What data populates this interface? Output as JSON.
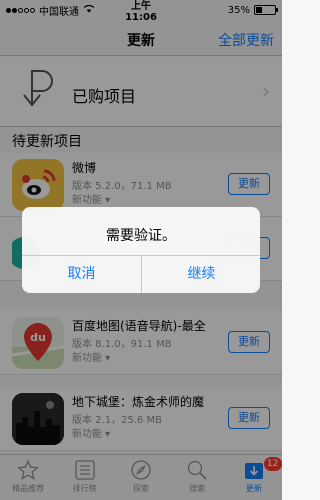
{
  "status_bar": {
    "carrier": "中国联通",
    "time": "上午11:06",
    "battery": "35%",
    "battery_level": 0.35
  },
  "nav": {
    "title": "更新",
    "update_all": "全部更新"
  },
  "purchased": {
    "label": "已购项目"
  },
  "section": {
    "title": "待更新项目"
  },
  "apps": [
    {
      "name": "微博",
      "meta": "版本 5.2.0，71.1 MB",
      "new_label": "新功能 ▾",
      "button": "更新"
    },
    {
      "name": "",
      "meta": "",
      "new_label": "",
      "button": "更新"
    },
    {
      "name": "百度地图(语音导航)-最全",
      "meta": "版本 8.1.0，91.1 MB",
      "new_label": "新功能 ▾",
      "button": "更新"
    },
    {
      "name": "地下城堡：炼金术师的魔",
      "meta": "版本 2.1，25.6 MB",
      "new_label": "新功能 ▾",
      "button": "更新"
    }
  ],
  "alert": {
    "title": "需要验证。",
    "cancel": "取消",
    "continue": "继续"
  },
  "tabbar": {
    "tabs": [
      {
        "label": "精品推荐",
        "icon": "star-icon"
      },
      {
        "label": "排行榜",
        "icon": "list-icon"
      },
      {
        "label": "探索",
        "icon": "compass-icon"
      },
      {
        "label": "搜索",
        "icon": "search-icon"
      },
      {
        "label": "更新",
        "icon": "download-icon"
      }
    ],
    "badge": "12"
  },
  "colors": {
    "accent": "#157efb",
    "badge": "#ff3b30"
  },
  "app_icons": {
    "weibo": "#f6c343",
    "baidu": "#e53935",
    "castle": "#222222"
  }
}
